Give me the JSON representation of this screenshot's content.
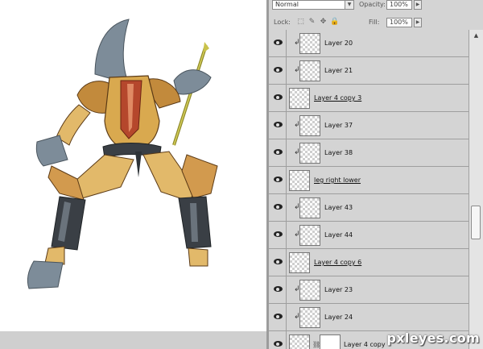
{
  "options": {
    "blend_mode": "Normal",
    "opacity_label": "Opacity:",
    "opacity_value": "100%",
    "lock_label": "Lock:",
    "fill_label": "Fill:",
    "fill_value": "100%"
  },
  "layers": [
    {
      "name": "Layer 20",
      "clipped": true,
      "underline": false,
      "visible": true
    },
    {
      "name": "Layer 21",
      "clipped": true,
      "underline": false,
      "visible": true
    },
    {
      "name": "Layer 4 copy 3",
      "clipped": false,
      "underline": true,
      "visible": true
    },
    {
      "name": "Layer 37",
      "clipped": true,
      "underline": false,
      "visible": true
    },
    {
      "name": "Layer 38",
      "clipped": true,
      "underline": false,
      "visible": true
    },
    {
      "name": "leg right lower",
      "clipped": false,
      "underline": true,
      "visible": true
    },
    {
      "name": "Layer 43",
      "clipped": true,
      "underline": false,
      "visible": true
    },
    {
      "name": "Layer 44",
      "clipped": true,
      "underline": false,
      "visible": true
    },
    {
      "name": "Layer 4 copy 6",
      "clipped": false,
      "underline": true,
      "visible": true
    },
    {
      "name": "Layer 23",
      "clipped": true,
      "underline": false,
      "visible": true
    },
    {
      "name": "Layer 24",
      "clipped": true,
      "underline": false,
      "visible": true
    },
    {
      "name": "Layer 4 copy",
      "clipped": false,
      "underline": false,
      "visible": true,
      "has_mask": true
    }
  ],
  "watermark": "pxleyes.com",
  "colors": {
    "panel_bg": "#d4d4d4",
    "armor_gold": "#d9a94f",
    "armor_dark": "#3a3f45",
    "steel_blue": "#7d8c99",
    "cloth_red": "#b5472c"
  }
}
